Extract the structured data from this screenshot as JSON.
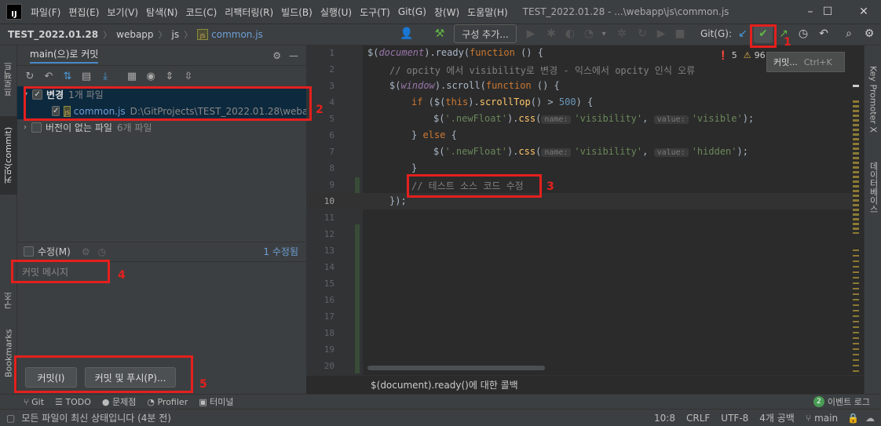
{
  "menubar": {
    "items": [
      "파일(F)",
      "편집(E)",
      "보기(V)",
      "탐색(N)",
      "코드(C)",
      "리팩터링(R)",
      "빌드(B)",
      "실행(U)",
      "도구(T)",
      "Git(G)",
      "창(W)",
      "도움말(H)"
    ],
    "window_title": "TEST_2022.01.28 - ...\\webapp\\js\\common.js",
    "min": "–",
    "max": "☐",
    "close": "✕"
  },
  "navbar": {
    "breadcrumbs": [
      "TEST_2022.01.28",
      "webapp",
      "js",
      "common.js"
    ],
    "config_button": "구성 추가...",
    "git_label": "Git(G):"
  },
  "left_strip": {
    "tabs": [
      "프로젝트",
      "커밋(commit)",
      "구조",
      "Bookmarks"
    ]
  },
  "right_strip": {
    "tabs": [
      "Key Promoter X",
      "데이터베이스"
    ]
  },
  "commit_panel": {
    "title": "main(으)로 커밋",
    "changes_group": "변경",
    "changes_count": "1개 파일",
    "file_name": "common.js",
    "file_path": "D:\\GitProjects\\TEST_2022.01.28\\webap",
    "unversioned_group": "버전이 없는 파일",
    "unversioned_count": "6개 파일",
    "amend_label": "수정(M)",
    "amend_count": "1 수정됨",
    "message_placeholder": "커밋 메시지",
    "commit_button": "커밋(I)",
    "commit_push_button": "커밋 및 푸시(P)..."
  },
  "editor": {
    "line_numbers": [
      "1",
      "2",
      "3",
      "4",
      "5",
      "6",
      "7",
      "8",
      "9",
      "10",
      "11",
      "12",
      "13",
      "14",
      "15",
      "16",
      "17",
      "18",
      "19",
      "20"
    ],
    "errors": "5",
    "warnings": "96",
    "tooltip": "커밋...",
    "tooltip_shortcut": "Ctrl+K",
    "hint_name": "name:",
    "hint_value": "value:",
    "breadcrumb_footer": "$(document).ready()에 대한 콜백",
    "code": {
      "l1_a": "$(",
      "l1_b": "document",
      "l1_c": ").ready(",
      "l1_d": "function",
      "l1_e": " () {",
      "l2": "// opcity 에서 visibility로 변경 - 익스에서 opcity 인식 오류",
      "l3_a": "$(",
      "l3_b": "window",
      "l3_c": ").scroll(",
      "l3_d": "function",
      "l3_e": " () {",
      "l4_a": "if",
      "l4_b": " ($(",
      "l4_c": "this",
      "l4_d": ").",
      "l4_e": "scrollTop",
      "l4_f": "() > ",
      "l4_g": "500",
      "l4_h": ") {",
      "l5_a": "$(",
      "l5_b": "'.newFloat'",
      "l5_c": ").",
      "l5_d": "css",
      "l5_e": "(",
      "l5_f": "'visibility'",
      "l5_g": ", ",
      "l5_h": "'visible'",
      "l5_i": ");",
      "l6_a": "} ",
      "l6_b": "else",
      "l6_c": " {",
      "l7_h": "'hidden'",
      "l8": "}",
      "l9": "// 테스트 소스 코드 수정",
      "l10": "});"
    }
  },
  "annotations": [
    "1",
    "2",
    "3",
    "4",
    "5"
  ],
  "bottom_tabs": [
    "Git",
    "TODO",
    "문제점",
    "Profiler",
    "터미널"
  ],
  "event_log": {
    "count": "2",
    "label": "이벤트 로그"
  },
  "status": {
    "message": "모든 파일이 최신 상태입니다 (4분 전)",
    "position": "10:8",
    "line_sep": "CRLF",
    "encoding": "UTF-8",
    "indent": "4개 공백",
    "branch": "main"
  },
  "colors": {
    "accent_red": "#e4201e",
    "check_green": "#62b543"
  }
}
